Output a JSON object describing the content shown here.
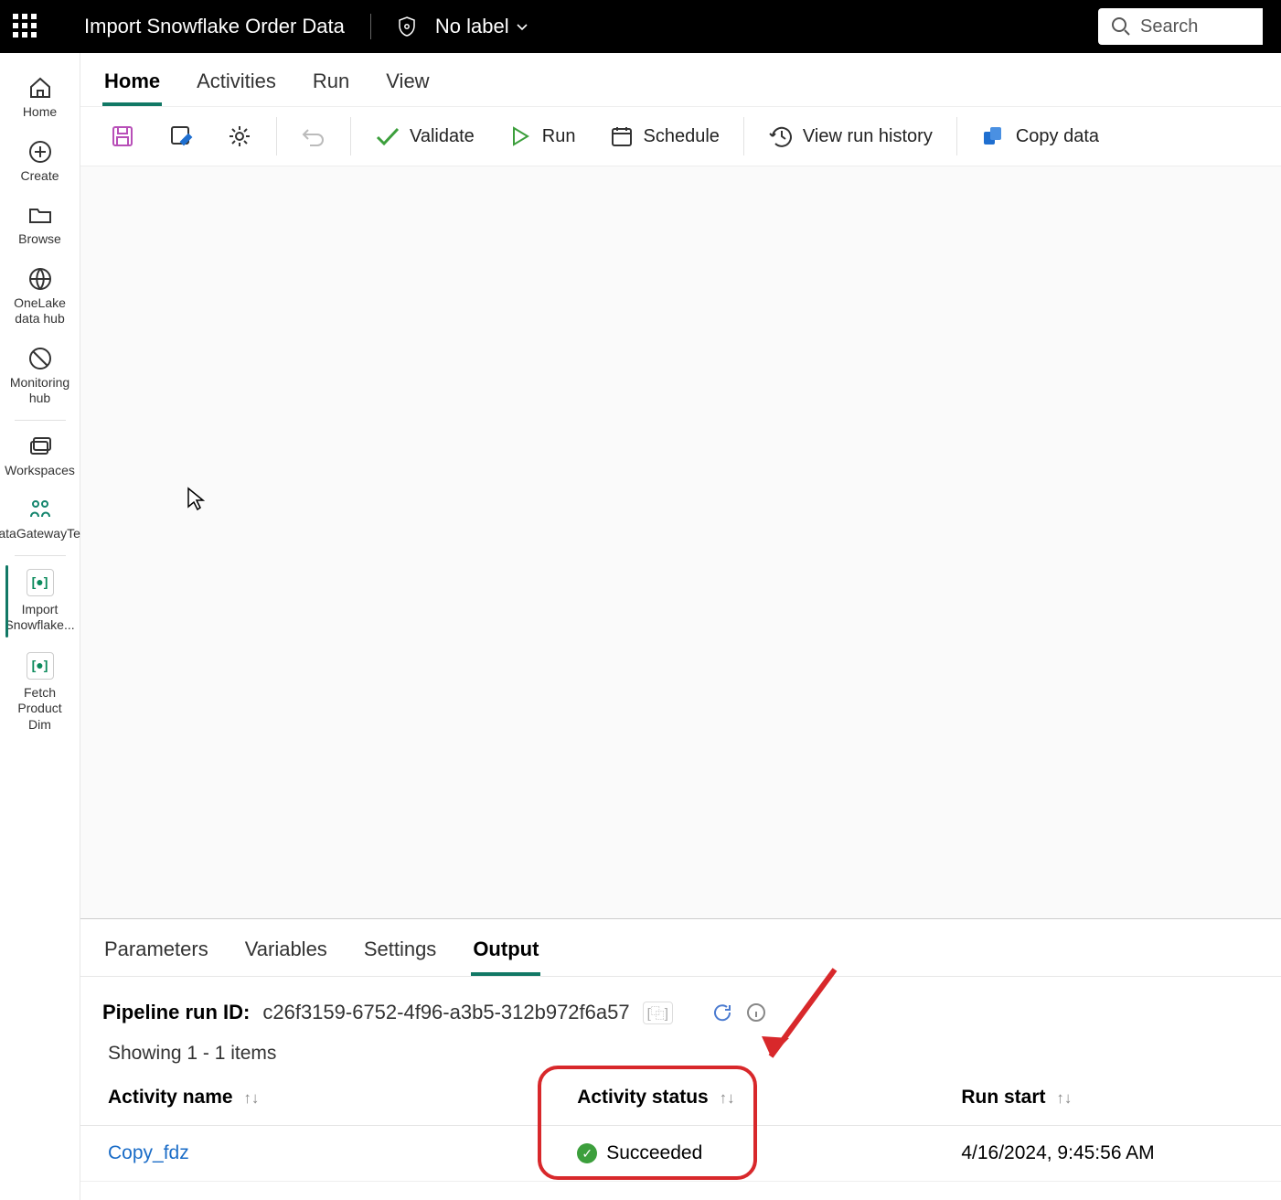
{
  "topbar": {
    "title": "Import Snowflake Order Data",
    "label_text": "No label",
    "search_placeholder": "Search"
  },
  "leftnav": {
    "items": [
      {
        "label": "Home"
      },
      {
        "label": "Create"
      },
      {
        "label": "Browse"
      },
      {
        "label": "OneLake data hub"
      },
      {
        "label": "Monitoring hub"
      },
      {
        "label": "Workspaces"
      },
      {
        "label": "DataGatewayTest"
      },
      {
        "label": "Import Snowflake..."
      },
      {
        "label": "Fetch Product Dim"
      }
    ]
  },
  "ribbon": {
    "tabs": [
      "Home",
      "Activities",
      "Run",
      "View"
    ],
    "active_tab": "Home"
  },
  "toolbar": {
    "validate": "Validate",
    "run": "Run",
    "schedule": "Schedule",
    "history": "View run history",
    "copydata": "Copy data"
  },
  "bottom": {
    "tabs": [
      "Parameters",
      "Variables",
      "Settings",
      "Output"
    ],
    "active_tab": "Output",
    "run_id_label": "Pipeline run ID:",
    "run_id": "c26f3159-6752-4f96-a3b5-312b972f6a57",
    "showing_text": "Showing 1 - 1 items",
    "columns": {
      "activity_name": "Activity name",
      "activity_status": "Activity status",
      "run_start": "Run start"
    },
    "rows": [
      {
        "activity_name": "Copy_fdz",
        "status": "Succeeded",
        "run_start": "4/16/2024, 9:45:56 AM"
      }
    ]
  }
}
